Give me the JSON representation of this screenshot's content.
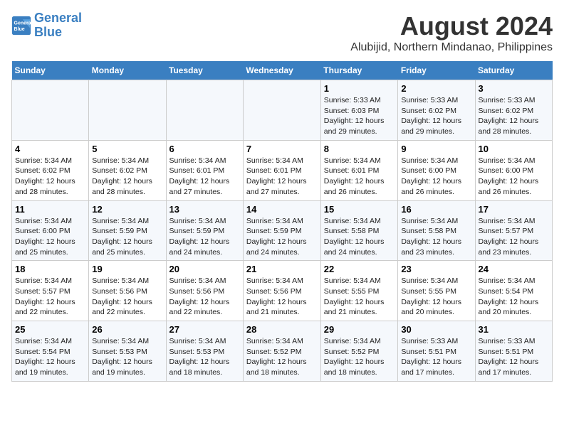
{
  "logo": {
    "line1": "General",
    "line2": "Blue"
  },
  "title": "August 2024",
  "subtitle": "Alubijid, Northern Mindanao, Philippines",
  "days_of_week": [
    "Sunday",
    "Monday",
    "Tuesday",
    "Wednesday",
    "Thursday",
    "Friday",
    "Saturday"
  ],
  "weeks": [
    [
      {
        "day": "",
        "content": ""
      },
      {
        "day": "",
        "content": ""
      },
      {
        "day": "",
        "content": ""
      },
      {
        "day": "",
        "content": ""
      },
      {
        "day": "1",
        "content": "Sunrise: 5:33 AM\nSunset: 6:03 PM\nDaylight: 12 hours and 29 minutes."
      },
      {
        "day": "2",
        "content": "Sunrise: 5:33 AM\nSunset: 6:02 PM\nDaylight: 12 hours and 29 minutes."
      },
      {
        "day": "3",
        "content": "Sunrise: 5:33 AM\nSunset: 6:02 PM\nDaylight: 12 hours and 28 minutes."
      }
    ],
    [
      {
        "day": "4",
        "content": "Sunrise: 5:34 AM\nSunset: 6:02 PM\nDaylight: 12 hours and 28 minutes."
      },
      {
        "day": "5",
        "content": "Sunrise: 5:34 AM\nSunset: 6:02 PM\nDaylight: 12 hours and 28 minutes."
      },
      {
        "day": "6",
        "content": "Sunrise: 5:34 AM\nSunset: 6:01 PM\nDaylight: 12 hours and 27 minutes."
      },
      {
        "day": "7",
        "content": "Sunrise: 5:34 AM\nSunset: 6:01 PM\nDaylight: 12 hours and 27 minutes."
      },
      {
        "day": "8",
        "content": "Sunrise: 5:34 AM\nSunset: 6:01 PM\nDaylight: 12 hours and 26 minutes."
      },
      {
        "day": "9",
        "content": "Sunrise: 5:34 AM\nSunset: 6:00 PM\nDaylight: 12 hours and 26 minutes."
      },
      {
        "day": "10",
        "content": "Sunrise: 5:34 AM\nSunset: 6:00 PM\nDaylight: 12 hours and 26 minutes."
      }
    ],
    [
      {
        "day": "11",
        "content": "Sunrise: 5:34 AM\nSunset: 6:00 PM\nDaylight: 12 hours and 25 minutes."
      },
      {
        "day": "12",
        "content": "Sunrise: 5:34 AM\nSunset: 5:59 PM\nDaylight: 12 hours and 25 minutes."
      },
      {
        "day": "13",
        "content": "Sunrise: 5:34 AM\nSunset: 5:59 PM\nDaylight: 12 hours and 24 minutes."
      },
      {
        "day": "14",
        "content": "Sunrise: 5:34 AM\nSunset: 5:59 PM\nDaylight: 12 hours and 24 minutes."
      },
      {
        "day": "15",
        "content": "Sunrise: 5:34 AM\nSunset: 5:58 PM\nDaylight: 12 hours and 24 minutes."
      },
      {
        "day": "16",
        "content": "Sunrise: 5:34 AM\nSunset: 5:58 PM\nDaylight: 12 hours and 23 minutes."
      },
      {
        "day": "17",
        "content": "Sunrise: 5:34 AM\nSunset: 5:57 PM\nDaylight: 12 hours and 23 minutes."
      }
    ],
    [
      {
        "day": "18",
        "content": "Sunrise: 5:34 AM\nSunset: 5:57 PM\nDaylight: 12 hours and 22 minutes."
      },
      {
        "day": "19",
        "content": "Sunrise: 5:34 AM\nSunset: 5:56 PM\nDaylight: 12 hours and 22 minutes."
      },
      {
        "day": "20",
        "content": "Sunrise: 5:34 AM\nSunset: 5:56 PM\nDaylight: 12 hours and 22 minutes."
      },
      {
        "day": "21",
        "content": "Sunrise: 5:34 AM\nSunset: 5:56 PM\nDaylight: 12 hours and 21 minutes."
      },
      {
        "day": "22",
        "content": "Sunrise: 5:34 AM\nSunset: 5:55 PM\nDaylight: 12 hours and 21 minutes."
      },
      {
        "day": "23",
        "content": "Sunrise: 5:34 AM\nSunset: 5:55 PM\nDaylight: 12 hours and 20 minutes."
      },
      {
        "day": "24",
        "content": "Sunrise: 5:34 AM\nSunset: 5:54 PM\nDaylight: 12 hours and 20 minutes."
      }
    ],
    [
      {
        "day": "25",
        "content": "Sunrise: 5:34 AM\nSunset: 5:54 PM\nDaylight: 12 hours and 19 minutes."
      },
      {
        "day": "26",
        "content": "Sunrise: 5:34 AM\nSunset: 5:53 PM\nDaylight: 12 hours and 19 minutes."
      },
      {
        "day": "27",
        "content": "Sunrise: 5:34 AM\nSunset: 5:53 PM\nDaylight: 12 hours and 18 minutes."
      },
      {
        "day": "28",
        "content": "Sunrise: 5:34 AM\nSunset: 5:52 PM\nDaylight: 12 hours and 18 minutes."
      },
      {
        "day": "29",
        "content": "Sunrise: 5:34 AM\nSunset: 5:52 PM\nDaylight: 12 hours and 18 minutes."
      },
      {
        "day": "30",
        "content": "Sunrise: 5:33 AM\nSunset: 5:51 PM\nDaylight: 12 hours and 17 minutes."
      },
      {
        "day": "31",
        "content": "Sunrise: 5:33 AM\nSunset: 5:51 PM\nDaylight: 12 hours and 17 minutes."
      }
    ]
  ]
}
